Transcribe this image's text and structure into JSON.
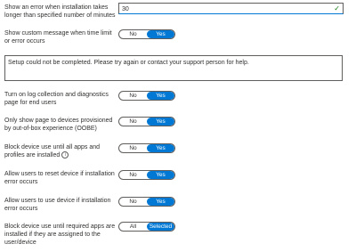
{
  "installation_timeout": {
    "label": "Show an error when installation takes longer than specified number of minutes",
    "value": "30",
    "status_icon": "checkmark-icon"
  },
  "custom_message": {
    "label": "Show custom message when time limit or error occurs",
    "options": [
      "No",
      "Yes"
    ],
    "selected": "Yes",
    "message_text": "Setup could not be completed. Please try again or contact your support person for help."
  },
  "log_collection": {
    "label": "Turn on log collection and diagnostics page for end users",
    "options": [
      "No",
      "Yes"
    ],
    "selected": "Yes"
  },
  "oobe_only": {
    "label": "Only show page to devices provisioned by out-of-box experience (OOBE)",
    "options": [
      "No",
      "Yes"
    ],
    "selected": "Yes"
  },
  "block_until_all": {
    "label": "Block device use until all apps and profiles are installed",
    "info_icon": "info-icon",
    "options": [
      "No",
      "Yes"
    ],
    "selected": "Yes"
  },
  "allow_reset": {
    "label": "Allow users to reset device if installation error occurs",
    "options": [
      "No",
      "Yes"
    ],
    "selected": "Yes"
  },
  "allow_use": {
    "label": "Allow users to use device if installation error occurs",
    "options": [
      "No",
      "Yes"
    ],
    "selected": "Yes"
  },
  "block_until_required": {
    "label": "Block device use until required apps are installed if they are assigned to the user/device",
    "options": [
      "All",
      "Selected"
    ],
    "selected": "Selected"
  },
  "colors": {
    "accent": "#0078d4",
    "border": "#605e5c",
    "success": "#107c10"
  }
}
